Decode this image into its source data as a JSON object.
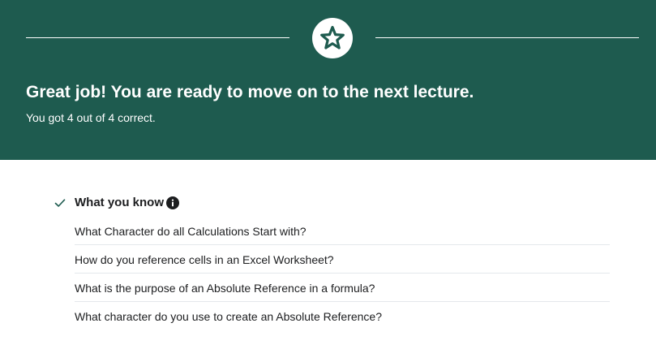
{
  "result": {
    "badge_icon": "star-icon",
    "headline": "Great job! You are ready to move on to the next lecture.",
    "score_text": "You got 4 out of 4 correct.",
    "banner_color": "#1e5b4f",
    "correct": 4,
    "total": 4
  },
  "what_you_know": {
    "title": "What you know",
    "status_icon": "check-icon",
    "info_icon": "info-icon",
    "questions": [
      "What Character do all Calculations Start with?",
      "How do you reference cells in an Excel Worksheet?",
      "What is the purpose of an Absolute Reference in a formula?",
      "What character do you use to create an Absolute Reference?"
    ]
  }
}
